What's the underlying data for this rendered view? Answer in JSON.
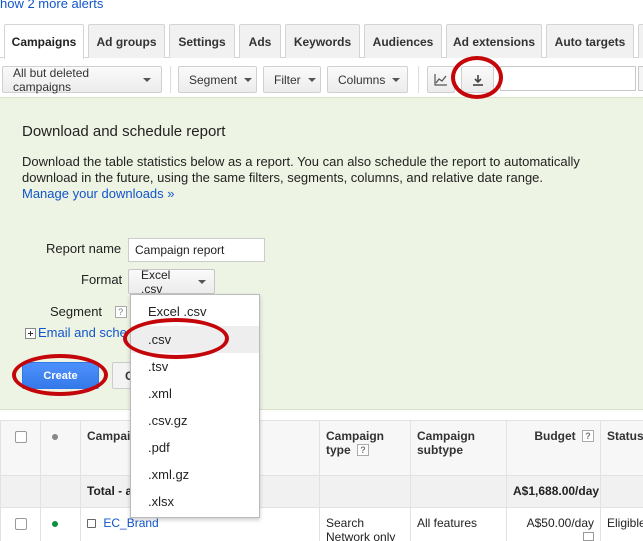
{
  "alerts": {
    "text": "how 2 more alerts"
  },
  "tabs": [
    {
      "label": "Campaigns",
      "active": true
    },
    {
      "label": "Ad groups"
    },
    {
      "label": "Settings"
    },
    {
      "label": "Ads"
    },
    {
      "label": "Keywords"
    },
    {
      "label": "Audiences"
    },
    {
      "label": "Ad extensions"
    },
    {
      "label": "Auto targets"
    }
  ],
  "toolbar": {
    "filter_view": "All but deleted campaigns",
    "segment": "Segment",
    "filter": "Filter",
    "columns": "Columns",
    "chart_icon": "line-chart-icon",
    "download_icon": "download-icon"
  },
  "panel": {
    "title": "Download and schedule report",
    "description": "Download the table statistics below as a report. You can also schedule the report to automatically download in the future, using the same filters, segments, columns, and relative date range.",
    "manage_link": "Manage your downloads »",
    "report_name_label": "Report name",
    "report_name_value": "Campaign report",
    "format_label": "Format",
    "format_value": "Excel .csv",
    "segment_label": "Segment",
    "help_glyph": "?",
    "email_link": "Email and sche",
    "create_label": "Create",
    "cancel_label": "C"
  },
  "dropdown": {
    "options": [
      "Excel .csv",
      ".csv",
      ".tsv",
      ".xml",
      ".csv.gz",
      ".pdf",
      ".xml.gz",
      ".xlsx"
    ],
    "highlighted": ".csv"
  },
  "table": {
    "headers": {
      "campaign": "Campaign",
      "campaign_type": "Campaign type",
      "campaign_subtype": "Campaign subtype",
      "budget": "Budget",
      "status": "Status"
    },
    "total": {
      "label": "Total - a",
      "budget": "A$1,688.00/day"
    },
    "rows": [
      {
        "name": "EC_Brand",
        "type": "Search Network only",
        "subtype": "All features",
        "budget": "A$50.00/day",
        "status": "Eligible"
      }
    ]
  },
  "colors": {
    "accent_blue": "#4d90fe",
    "link_blue": "#1155cc",
    "annotation_red": "#c4060b",
    "panel_green": "#eef4e3",
    "status_green": "#0a8f3c"
  }
}
